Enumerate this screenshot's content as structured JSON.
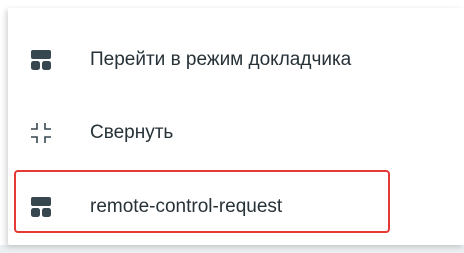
{
  "menu": {
    "items": [
      {
        "label": "Перейти в режим докладчика",
        "icon": "presenter-mode-icon"
      },
      {
        "label": "Свернуть",
        "icon": "collapse-icon"
      },
      {
        "label": "remote-control-request",
        "icon": "remote-control-icon"
      }
    ],
    "highlight_color": "#e53935",
    "icon_color": "#37474f",
    "text_color": "#263238"
  }
}
